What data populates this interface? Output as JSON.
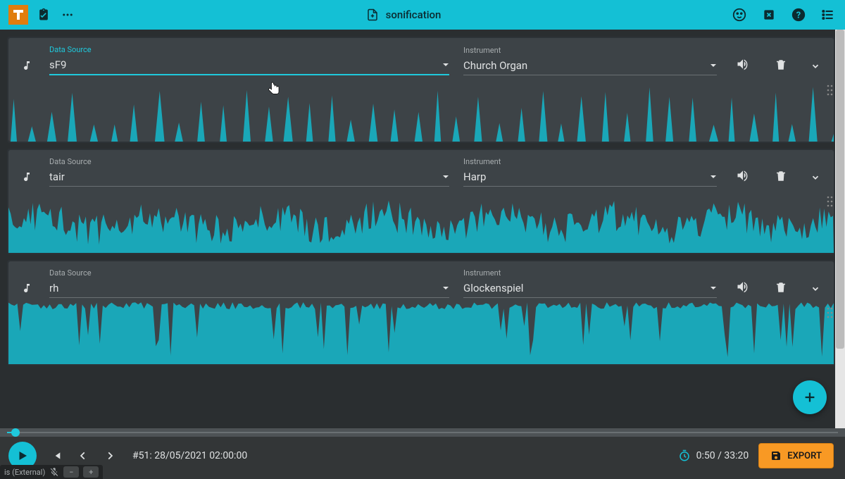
{
  "header": {
    "project_title": "sonification"
  },
  "tracks": [
    {
      "data_source_label": "Data Source",
      "data_source_value": "sF9",
      "instrument_label": "Instrument",
      "instrument_value": "Church Organ",
      "active": true,
      "wave_shape": "peaks"
    },
    {
      "data_source_label": "Data Source",
      "data_source_value": "tair",
      "instrument_label": "Instrument",
      "instrument_value": "Harp",
      "active": false,
      "wave_shape": "noise"
    },
    {
      "data_source_label": "Data Source",
      "data_source_value": "rh",
      "instrument_label": "Instrument",
      "instrument_value": "Glockenspiel",
      "active": false,
      "wave_shape": "fill"
    }
  ],
  "transport": {
    "frame_label": "#51: 28/05/2021 02:00:00",
    "time_current": "0:50",
    "time_total": "33:20",
    "export_label": "EXPORT"
  },
  "status": {
    "text": "is (External)"
  },
  "colors": {
    "accent": "#14c0d5",
    "wave": "#1aa7b8",
    "orange": "#f89924"
  }
}
